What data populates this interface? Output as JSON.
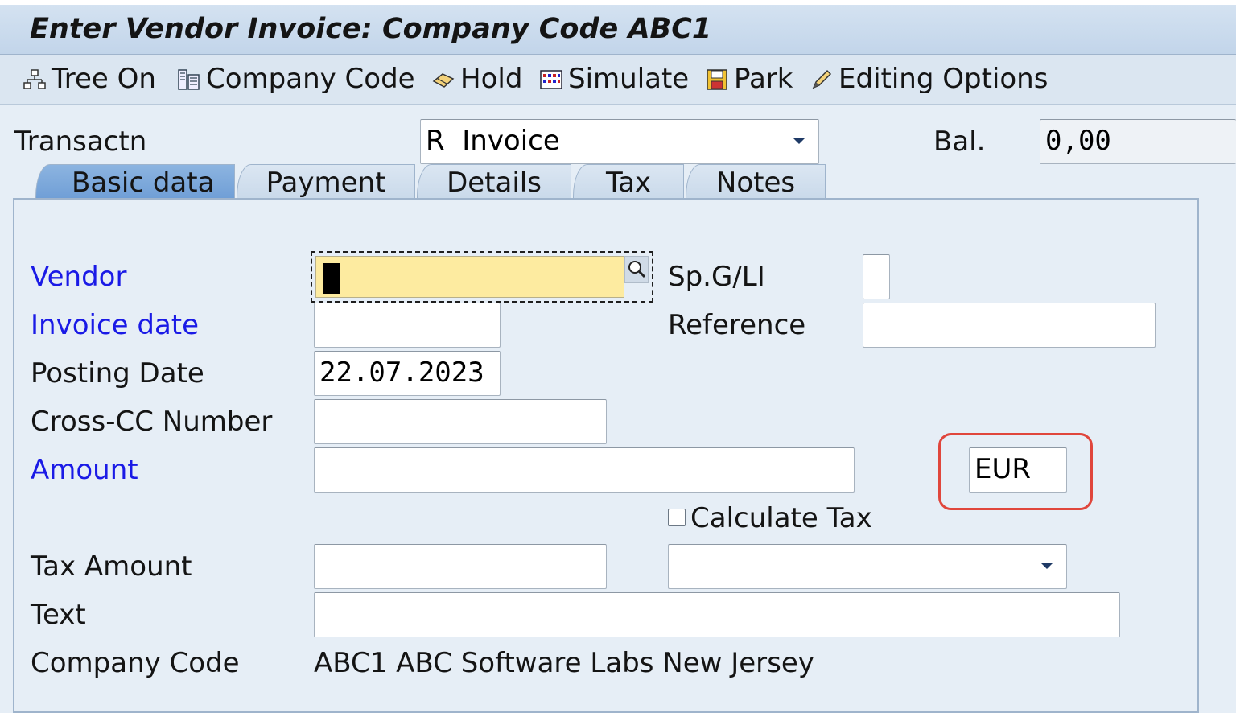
{
  "window": {
    "title": "Enter Vendor Invoice: Company Code ABC1"
  },
  "toolbar": {
    "tree_on": "Tree On",
    "company_code": "Company Code",
    "hold": "Hold",
    "simulate": "Simulate",
    "park": "Park",
    "editing_options": "Editing Options"
  },
  "header": {
    "transaction_label": "Transactn",
    "transaction_value": "R  Invoice",
    "balance_label": "Bal.",
    "balance_value": "0,00"
  },
  "tabs": [
    {
      "label": "Basic data",
      "active": true
    },
    {
      "label": "Payment",
      "active": false
    },
    {
      "label": "Details",
      "active": false
    },
    {
      "label": "Tax",
      "active": false
    },
    {
      "label": "Notes",
      "active": false
    }
  ],
  "form": {
    "vendor_label": "Vendor",
    "vendor_value": "",
    "spgl_label": "Sp.G/LI",
    "spgl_value": "",
    "invoice_date_label": "Invoice date",
    "invoice_date_value": "",
    "reference_label": "Reference",
    "reference_value": "",
    "posting_date_label": "Posting Date",
    "posting_date_value": "22.07.2023",
    "cross_cc_label": "Cross-CC Number",
    "cross_cc_value": "",
    "amount_label": "Amount",
    "amount_value": "",
    "currency_value": "EUR",
    "calculate_tax_label": "Calculate Tax",
    "calculate_tax_checked": false,
    "tax_amount_label": "Tax Amount",
    "tax_amount_value": "",
    "tax_code_value": "",
    "text_label": "Text",
    "text_value": "",
    "company_code_label": "Company Code",
    "company_code_value": "ABC1 ABC Software Labs New Jersey"
  },
  "colors": {
    "link_label": "#1a1ae6",
    "active_tab": "#7aa6da",
    "highlight": "#e0463c",
    "required_field": "#fdeba0"
  }
}
